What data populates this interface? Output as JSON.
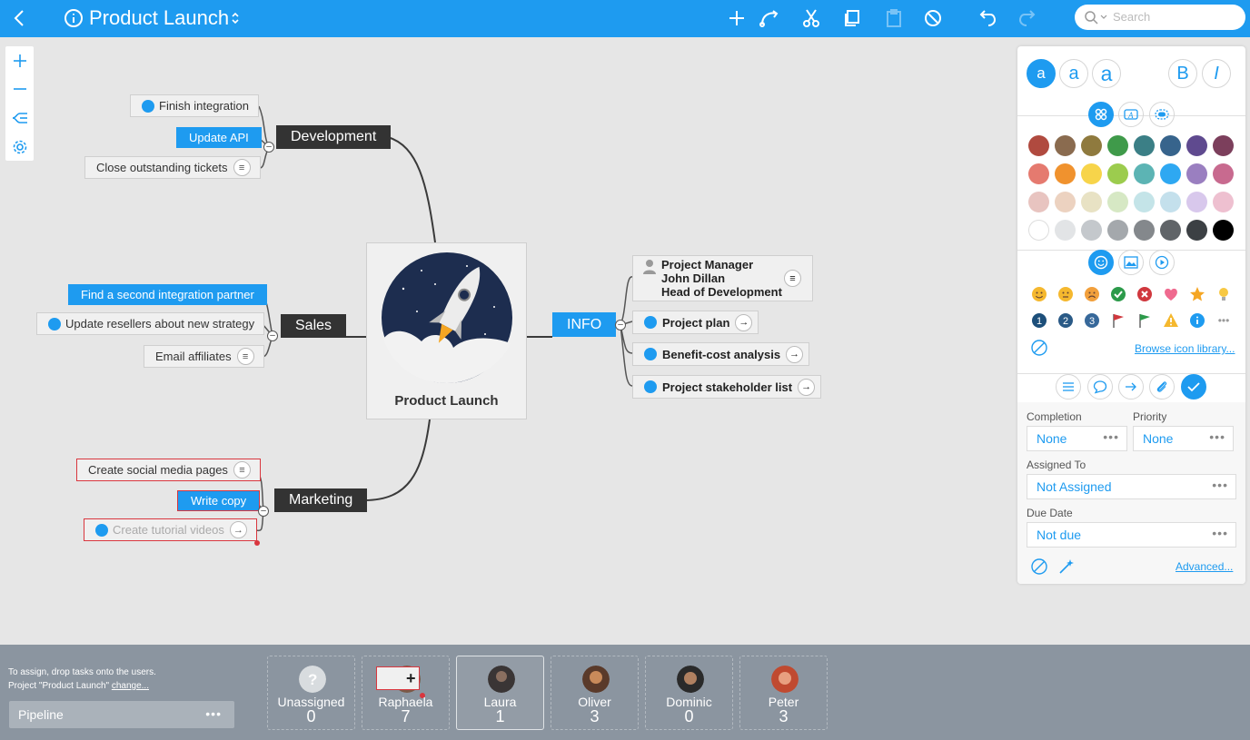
{
  "topbar": {
    "title": "Product Launch",
    "search_placeholder": "Search"
  },
  "map": {
    "central_label": "Product Launch",
    "branches": {
      "development": {
        "label": "Development",
        "children": [
          "Finish integration",
          "Update API",
          "Close outstanding tickets"
        ]
      },
      "sales": {
        "label": "Sales",
        "children": [
          "Find a second integration partner",
          "Update resellers about new strategy",
          "Email affiliates"
        ]
      },
      "marketing": {
        "label": "Marketing",
        "children": [
          "Create social media pages",
          "Write copy",
          "Create tutorial videos"
        ]
      },
      "info": {
        "label": "INFO",
        "contact": [
          "Project Manager",
          "John Dillan",
          "Head of Development"
        ],
        "children": [
          "Project plan",
          "Benefit-cost analysis",
          "Project stakeholder list"
        ]
      }
    }
  },
  "panel": {
    "font_sizes": [
      "a",
      "a",
      "a"
    ],
    "bold": "B",
    "italic": "I",
    "colors": [
      [
        "#b04a3f",
        "#8a6b4f",
        "#8f7a3e",
        "#3f9a4a",
        "#3b7f86",
        "#37648c",
        "#5f4a8f",
        "#7c3f5c"
      ],
      [
        "#e57a6f",
        "#f0922e",
        "#f7d44a",
        "#9ccc4e",
        "#5cb4b4",
        "#2ea8f2",
        "#9a7fc0",
        "#c86a8f"
      ],
      [
        "#e8c4c0",
        "#ecd2c0",
        "#e8e2c4",
        "#d6e8c4",
        "#c4e4e8",
        "#c4e0ec",
        "#d8c8ec",
        "#eec0d0"
      ],
      [
        "#ffffff",
        "#e2e4e6",
        "#c4c8cc",
        "#a4a8ac",
        "#84888c",
        "#606468",
        "#3c4044",
        "#000000"
      ]
    ],
    "browse_link": "Browse icon library...",
    "completion_label": "Completion",
    "completion_value": "None",
    "priority_label": "Priority",
    "priority_value": "None",
    "assigned_label": "Assigned To",
    "assigned_value": "Not Assigned",
    "due_label": "Due Date",
    "due_value": "Not due",
    "advanced_link": "Advanced...",
    "more": "•••"
  },
  "bottom": {
    "hint_line1": "To assign, drop tasks onto the users.",
    "hint_line2": "Project \"Product Launch\"",
    "hint_change": "change...",
    "pipeline": "Pipeline",
    "pipeline_more": "•••",
    "users": [
      {
        "name": "Unassigned",
        "count": "0"
      },
      {
        "name": "Raphaela",
        "count": "7"
      },
      {
        "name": "Laura",
        "count": "1"
      },
      {
        "name": "Oliver",
        "count": "3"
      },
      {
        "name": "Dominic",
        "count": "0"
      },
      {
        "name": "Peter",
        "count": "3"
      }
    ]
  }
}
